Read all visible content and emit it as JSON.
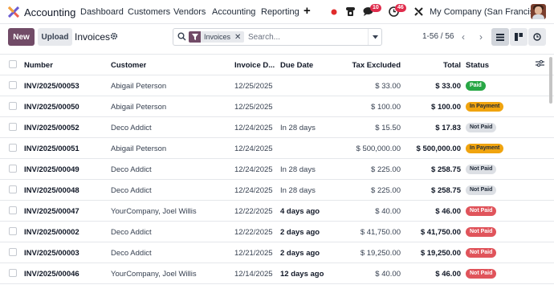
{
  "app": {
    "title": "Accounting",
    "menu": [
      "Dashboard",
      "Customers",
      "Vendors",
      "Accounting",
      "Reporting"
    ],
    "plus_icon": "plus-icon",
    "notifications": {
      "messages": "10",
      "activities": "46"
    },
    "company": "My Company (San Francisco)"
  },
  "control": {
    "new_label": "New",
    "upload_label": "Upload",
    "page_title": "Invoices",
    "facet_label": "Invoices",
    "search_placeholder": "Search...",
    "pager": "1-56 / 56"
  },
  "table": {
    "columns": {
      "number": "Number",
      "customer": "Customer",
      "invoice_date": "Invoice D...",
      "due_date": "Due Date",
      "tax_excluded": "Tax Excluded",
      "total": "Total",
      "status": "Status"
    },
    "rows": [
      {
        "number": "INV/2025/00053",
        "customer": "Abigail Peterson",
        "invoice_date": "12/25/2025",
        "due_date": "",
        "due_late": false,
        "tax_excluded": "$ 33.00",
        "total": "$ 33.00",
        "status": "Paid",
        "status_type": "paid"
      },
      {
        "number": "INV/2025/00050",
        "customer": "Abigail Peterson",
        "invoice_date": "12/25/2025",
        "due_date": "",
        "due_late": false,
        "tax_excluded": "$ 100.00",
        "total": "$ 100.00",
        "status": "In Payment",
        "status_type": "inpay"
      },
      {
        "number": "INV/2025/00052",
        "customer": "Deco Addict",
        "invoice_date": "12/24/2025",
        "due_date": "In 28 days",
        "due_late": false,
        "tax_excluded": "$ 15.50",
        "total": "$ 17.83",
        "status": "Not Paid",
        "status_type": "notpaid"
      },
      {
        "number": "INV/2025/00051",
        "customer": "Abigail Peterson",
        "invoice_date": "12/24/2025",
        "due_date": "",
        "due_late": false,
        "tax_excluded": "$ 500,000.00",
        "total": "$ 500,000.00",
        "status": "In Payment",
        "status_type": "inpay"
      },
      {
        "number": "INV/2025/00049",
        "customer": "Deco Addict",
        "invoice_date": "12/24/2025",
        "due_date": "In 28 days",
        "due_late": false,
        "tax_excluded": "$ 225.00",
        "total": "$ 258.75",
        "status": "Not Paid",
        "status_type": "notpaid"
      },
      {
        "number": "INV/2025/00048",
        "customer": "Deco Addict",
        "invoice_date": "12/24/2025",
        "due_date": "In 28 days",
        "due_late": false,
        "tax_excluded": "$ 225.00",
        "total": "$ 258.75",
        "status": "Not Paid",
        "status_type": "notpaid"
      },
      {
        "number": "INV/2025/00047",
        "customer": "YourCompany, Joel Willis",
        "invoice_date": "12/22/2025",
        "due_date": "4 days ago",
        "due_late": true,
        "tax_excluded": "$ 40.00",
        "total": "$ 46.00",
        "status": "Not Paid",
        "status_type": "notpaid-late"
      },
      {
        "number": "INV/2025/00002",
        "customer": "Deco Addict",
        "invoice_date": "12/22/2025",
        "due_date": "2 days ago",
        "due_late": true,
        "tax_excluded": "$ 41,750.00",
        "total": "$ 41,750.00",
        "status": "Not Paid",
        "status_type": "notpaid-late"
      },
      {
        "number": "INV/2025/00003",
        "customer": "Deco Addict",
        "invoice_date": "12/21/2025",
        "due_date": "2 days ago",
        "due_late": true,
        "tax_excluded": "$ 19,250.00",
        "total": "$ 19,250.00",
        "status": "Not Paid",
        "status_type": "notpaid-late"
      },
      {
        "number": "INV/2025/00046",
        "customer": "YourCompany, Joel Willis",
        "invoice_date": "12/14/2025",
        "due_date": "12 days ago",
        "due_late": true,
        "tax_excluded": "$ 40.00",
        "total": "$ 46.00",
        "status": "Not Paid",
        "status_type": "notpaid-late"
      }
    ]
  },
  "colors": {
    "brand": "#714b67",
    "paid": "#28a745",
    "in_payment": "#f0a40f",
    "not_paid_late": "#e0545b",
    "late_text": "#d9363e"
  }
}
